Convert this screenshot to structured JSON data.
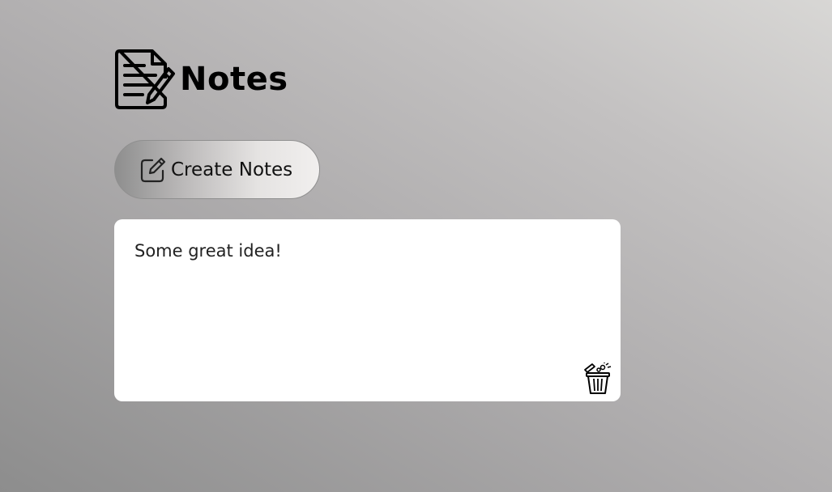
{
  "header": {
    "title": "Notes",
    "icon": "notes-document-icon"
  },
  "toolbar": {
    "create_label": "Create Notes",
    "create_icon": "edit-icon"
  },
  "notes": [
    {
      "text": "Some great idea!",
      "delete_icon": "trash-icon"
    }
  ]
}
